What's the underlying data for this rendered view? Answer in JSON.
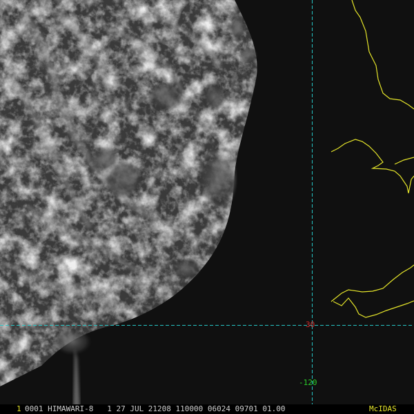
{
  "image": {
    "kind": "satellite-visible-imagery",
    "background": "#000000"
  },
  "overlay": {
    "grid_color": "#26c6c6",
    "coastline_color": "#e6e62a",
    "latitude_label": {
      "text": "30",
      "color": "#d42a2a"
    },
    "longitude_label": {
      "text": "-120",
      "color": "#2ad12a"
    }
  },
  "status_bar": {
    "frame_number": "1",
    "frame_number_color": "#e6e62a",
    "text": "0001 HIMAWARI-8   1 27 JUL 21208 110000 06024 09701 01.00",
    "text_color": "#cfcfcf",
    "branding": "McIDAS",
    "branding_color": "#e6e62a"
  }
}
